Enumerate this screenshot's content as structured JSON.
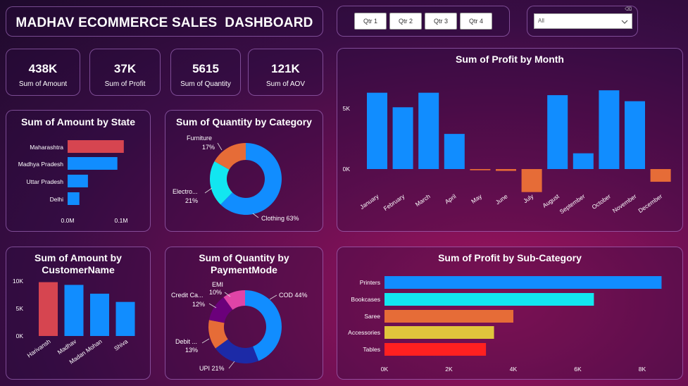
{
  "title": "MADHAV ECOMMERCE SALES  DASHBOARD",
  "quarters": [
    "Qtr 1",
    "Qtr 2",
    "Qtr 3",
    "Qtr 4"
  ],
  "dropdown": {
    "value": "All",
    "clear_icon": "eraser-icon",
    "arrow_icon": "chevron-down-icon"
  },
  "kpis": [
    {
      "value": "438K",
      "label": "Sum of Amount"
    },
    {
      "value": "37K",
      "label": "Sum of Profit"
    },
    {
      "value": "5615",
      "label": "Sum of Quantity"
    },
    {
      "value": "121K",
      "label": "Sum of AOV"
    }
  ],
  "colors": {
    "blue": "#118dff",
    "red": "#d64550",
    "orange": "#e66c37",
    "cyan": "#12e6f0",
    "purple": "#6b007b",
    "pink": "#e044a7",
    "navy": "#1c2aa7",
    "yellow": "#e0c53c",
    "brightred": "#ff2020"
  },
  "chart_data": [
    {
      "id": "amount_by_state",
      "type": "bar",
      "orientation": "horizontal",
      "title": "Sum of Amount by State",
      "categories": [
        "Maharashtra",
        "Madhya Pradesh",
        "Uttar Pradesh",
        "Delhi"
      ],
      "values": [
        0.105,
        0.093,
        0.038,
        0.022
      ],
      "colors": [
        "#d64550",
        "#118dff",
        "#118dff",
        "#118dff"
      ],
      "xticks": [
        "0.0M",
        "0.1M"
      ],
      "xlim": [
        0,
        0.1
      ]
    },
    {
      "id": "quantity_by_category",
      "type": "pie",
      "donut": true,
      "title": "Sum of Quantity by Category",
      "labels": [
        "Clothing",
        "Electronics",
        "Furniture"
      ],
      "display_labels": [
        [
          "Clothing 63%"
        ],
        [
          "Electro...",
          "21%"
        ],
        [
          "Furniture",
          "17%"
        ]
      ],
      "values": [
        63,
        21,
        17
      ],
      "colors": [
        "#118dff",
        "#12e6f0",
        "#e66c37"
      ]
    },
    {
      "id": "profit_by_month",
      "type": "bar",
      "title": "Sum of Profit by Month",
      "categories": [
        "January",
        "February",
        "March",
        "April",
        "May",
        "June",
        "July",
        "August",
        "September",
        "October",
        "November",
        "December"
      ],
      "values": [
        6300,
        5100,
        6300,
        2900,
        -100,
        -150,
        -1900,
        6100,
        1300,
        6500,
        5600,
        -1050
      ],
      "colors": [
        "#118dff",
        "#118dff",
        "#118dff",
        "#118dff",
        "#e66c37",
        "#e66c37",
        "#e66c37",
        "#118dff",
        "#118dff",
        "#118dff",
        "#118dff",
        "#e66c37"
      ],
      "yticks": [
        "0K",
        "5K"
      ],
      "ylim": [
        -2000,
        7000
      ]
    },
    {
      "id": "amount_by_customer",
      "type": "bar",
      "title": "Sum of Amount by CustomerName",
      "categories": [
        "Harivansh",
        "Madhav",
        "Madan Mohan",
        "Shiva"
      ],
      "values": [
        9800,
        9300,
        7700,
        6200
      ],
      "colors": [
        "#d64550",
        "#118dff",
        "#118dff",
        "#118dff"
      ],
      "yticks": [
        "0K",
        "5K",
        "10K"
      ],
      "ylim": [
        0,
        10000
      ]
    },
    {
      "id": "quantity_by_paymentmode",
      "type": "pie",
      "donut": true,
      "title": "Sum of Quantity by PaymentMode",
      "labels": [
        "COD",
        "UPI",
        "Debit Card",
        "Credit Card",
        "EMI"
      ],
      "display_labels": [
        [
          "COD 44%"
        ],
        [
          "UPI 21%"
        ],
        [
          "Debit ...",
          "13%"
        ],
        [
          "Credit Ca...",
          "12%"
        ],
        [
          "EMI",
          "10%"
        ]
      ],
      "values": [
        44,
        21,
        13,
        12,
        10
      ],
      "colors": [
        "#118dff",
        "#1c2aa7",
        "#e66c37",
        "#6b007b",
        "#e044a7"
      ]
    },
    {
      "id": "profit_by_subcategory",
      "type": "bar",
      "orientation": "horizontal",
      "title": "Sum of Profit by Sub-Category",
      "categories": [
        "Printers",
        "Bookcases",
        "Saree",
        "Accessories",
        "Tables"
      ],
      "values": [
        8600,
        6500,
        4000,
        3400,
        3150
      ],
      "colors": [
        "#118dff",
        "#12e6f0",
        "#e66c37",
        "#e0c53c",
        "#ff2020"
      ],
      "xticks": [
        "0K",
        "2K",
        "4K",
        "6K",
        "8K"
      ],
      "xlim": [
        0,
        8000
      ]
    }
  ]
}
